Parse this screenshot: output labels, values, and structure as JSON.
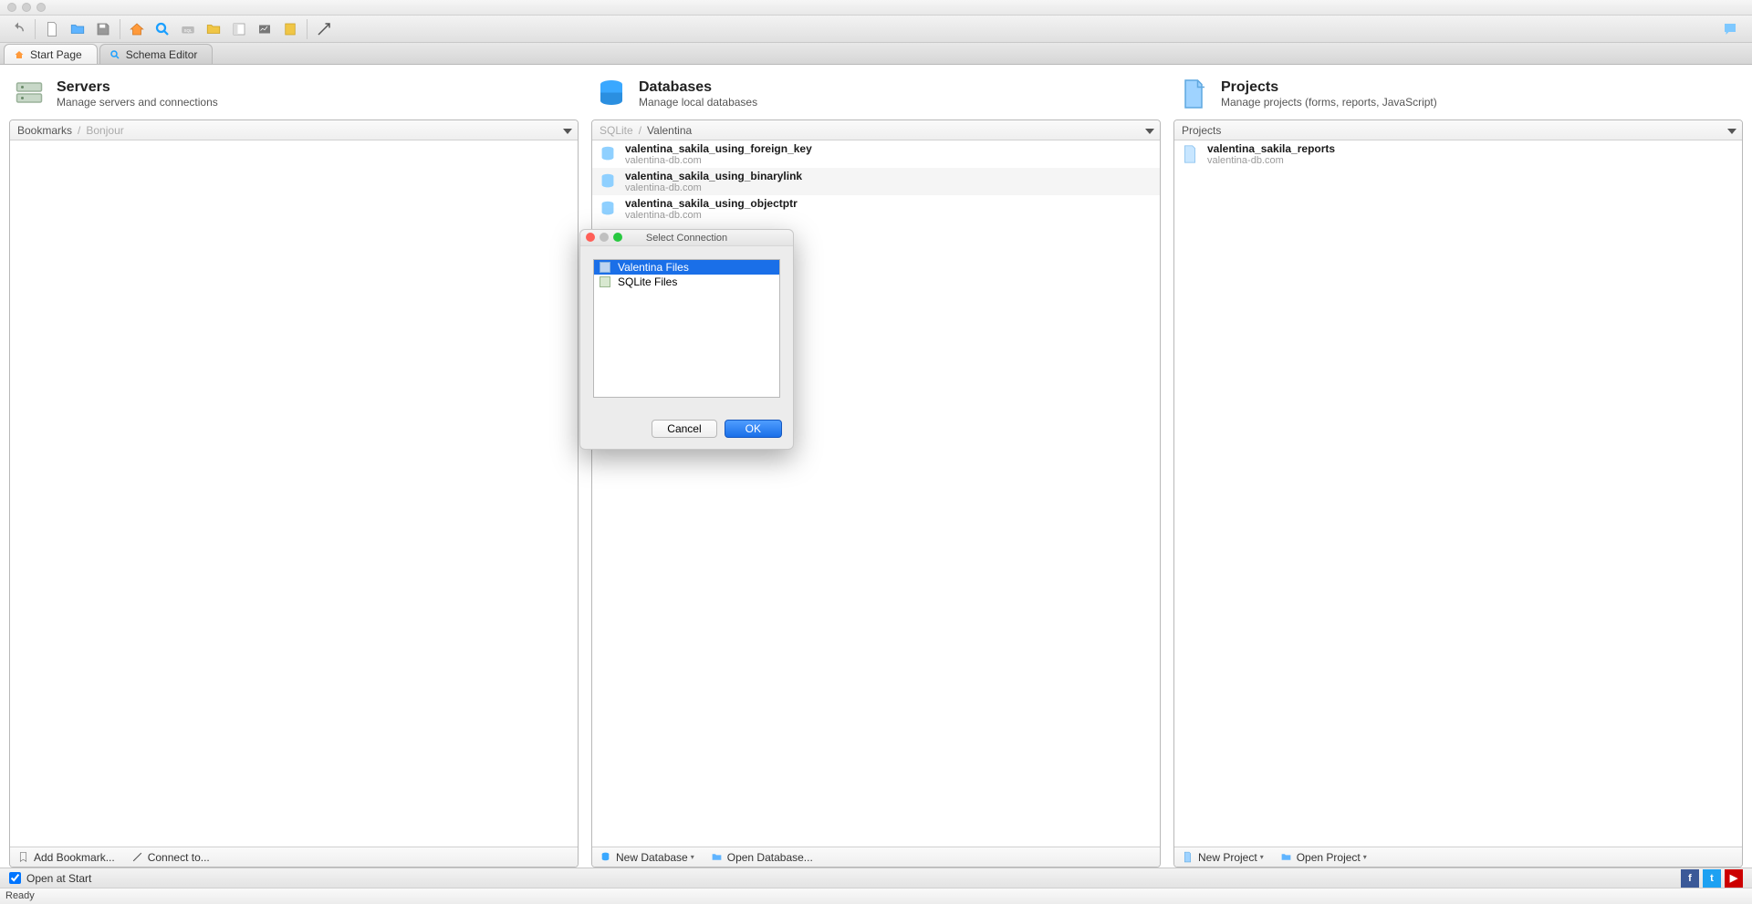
{
  "tabs": {
    "start": "Start Page",
    "schema": "Schema Editor"
  },
  "servers": {
    "title": "Servers",
    "subtitle": "Manage servers and connections",
    "crumb1": "Bookmarks",
    "crumb2": "Bonjour",
    "footer_add": "Add Bookmark...",
    "footer_connect": "Connect to..."
  },
  "databases": {
    "title": "Databases",
    "subtitle": "Manage local databases",
    "crumb1": "SQLite",
    "crumb2": "Valentina",
    "items": [
      {
        "name": "valentina_sakila_using_foreign_key",
        "sub": "valentina-db.com"
      },
      {
        "name": "valentina_sakila_using_binarylink",
        "sub": "valentina-db.com"
      },
      {
        "name": "valentina_sakila_using_objectptr",
        "sub": "valentina-db.com"
      }
    ],
    "footer_new": "New Database",
    "footer_open": "Open Database..."
  },
  "projects": {
    "title": "Projects",
    "subtitle": "Manage projects (forms, reports, JavaScript)",
    "crumb1": "Projects",
    "items": [
      {
        "name": "valentina_sakila_reports",
        "sub": "valentina-db.com"
      }
    ],
    "footer_new": "New Project",
    "footer_open": "Open Project"
  },
  "modal": {
    "title": "Select Connection",
    "opt1": "Valentina Files",
    "opt2": "SQLite Files",
    "cancel": "Cancel",
    "ok": "OK"
  },
  "footer": {
    "open_at_start": "Open at Start",
    "ready": "Ready"
  }
}
